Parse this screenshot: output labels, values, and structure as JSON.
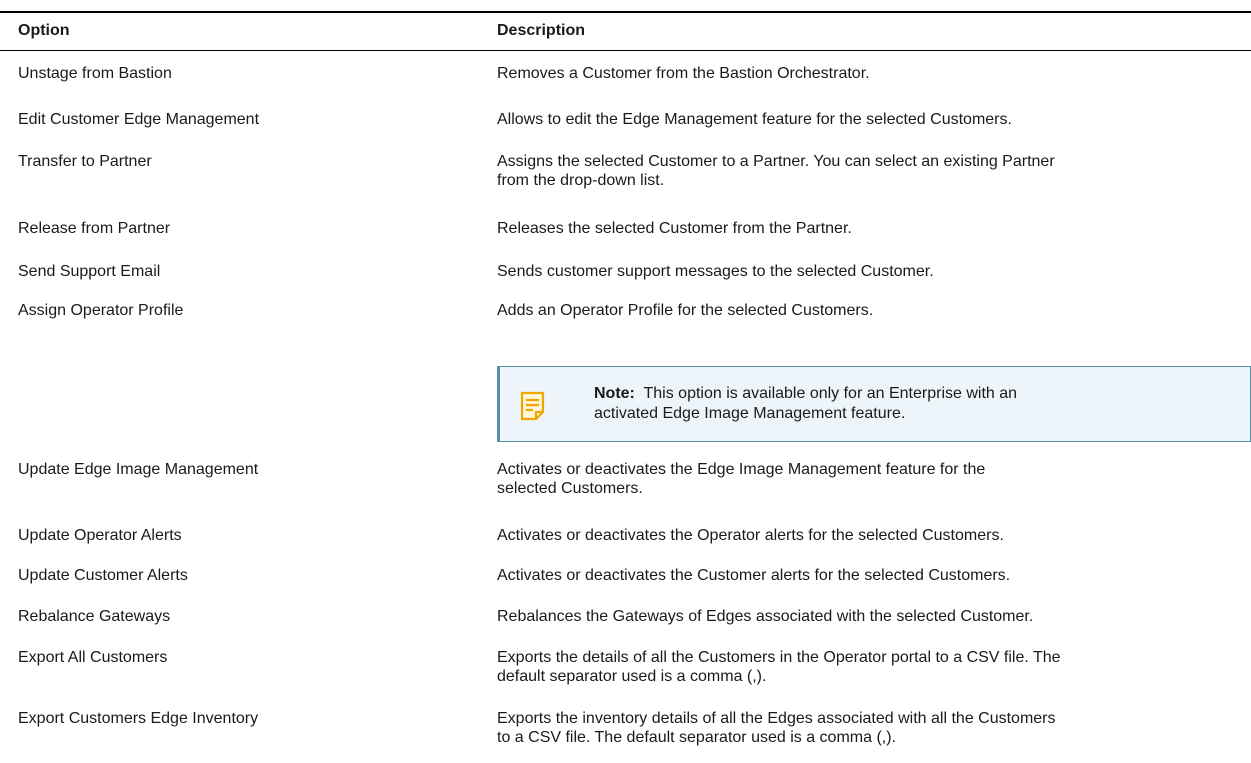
{
  "table": {
    "headers": {
      "option": "Option",
      "description": "Description"
    },
    "rows": [
      {
        "option": "Unstage from Bastion",
        "description": "Removes a Customer from the Bastion Orchestrator."
      },
      {
        "option": "Edit Customer Edge Management",
        "description": "Allows to edit the Edge Management feature for the selected Customers."
      },
      {
        "option": "Transfer to Partner",
        "description_line1": "Assigns the selected Customer to a Partner. You can select an existing Partner",
        "description_line2": "from the drop-down list."
      },
      {
        "option": "Release from Partner",
        "description": "Releases the selected Customer from the Partner."
      },
      {
        "option": "Send Support Email",
        "description": "Sends customer support messages to the selected Customer."
      },
      {
        "option": "Assign Operator Profile",
        "description": "Adds an Operator Profile for the selected Customers.",
        "note": {
          "label": "Note:",
          "line1": "This option is available only for an Enterprise with an",
          "line2": "activated Edge Image Management feature."
        }
      },
      {
        "option": "Update Edge Image Management",
        "description_line1": "Activates or deactivates the Edge Image Management feature for the",
        "description_line2": "selected Customers."
      },
      {
        "option": "Update Operator Alerts",
        "description": "Activates or deactivates the Operator alerts for the selected Customers."
      },
      {
        "option": "Update Customer Alerts",
        "description": "Activates or deactivates the Customer alerts for the selected Customers."
      },
      {
        "option": "Rebalance Gateways",
        "description": "Rebalances the Gateways of Edges associated with the selected Customer."
      },
      {
        "option": "Export All Customers",
        "description_line1": "Exports the details of all the Customers in the Operator portal to a CSV file. The",
        "description_line2": "default separator used is a comma (,)."
      },
      {
        "option": "Export Customers Edge Inventory",
        "description_line1": "Exports the inventory details of all the Edges associated with all the Customers",
        "description_line2": "to a CSV file. The default separator used is a comma (,)."
      }
    ]
  },
  "icons": {
    "note": "note-icon"
  },
  "colors": {
    "note_border": "#5c8fa6",
    "note_bg": "#eef5fa",
    "note_icon": "#f0a500"
  }
}
